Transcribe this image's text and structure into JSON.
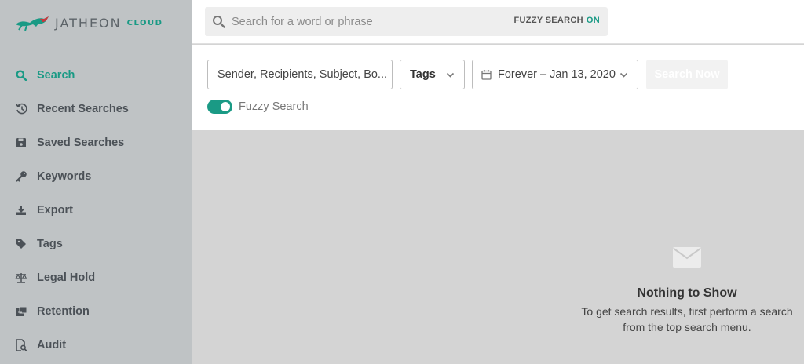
{
  "brand": {
    "name": "JATHEON",
    "suffix": "CLOUD"
  },
  "colors": {
    "accent": "#1a9a85",
    "sidebar": "#bfc3c5",
    "content": "#d4d4d4"
  },
  "sidebar": {
    "items": [
      {
        "label": "Search",
        "icon": "search-icon",
        "active": true
      },
      {
        "label": "Recent Searches",
        "icon": "history-icon"
      },
      {
        "label": "Saved Searches",
        "icon": "save-icon"
      },
      {
        "label": "Keywords",
        "icon": "key-icon"
      },
      {
        "label": "Export",
        "icon": "download-icon"
      },
      {
        "label": "Tags",
        "icon": "tag-icon"
      },
      {
        "label": "Legal Hold",
        "icon": "scale-icon"
      },
      {
        "label": "Retention",
        "icon": "archive-icon"
      },
      {
        "label": "Audit",
        "icon": "audit-icon"
      }
    ]
  },
  "topbar": {
    "search_placeholder": "Search for a word or phrase",
    "fuzzy_label": "FUZZY SEARCH",
    "fuzzy_state": "ON"
  },
  "toolbar": {
    "query_fields": "Sender, Recipients, Subject, Bo...",
    "tags_label": "Tags",
    "date_range": "Forever – Jan 13, 2020",
    "search_button": "Search Now",
    "fuzzy_toggle_label": "Fuzzy Search",
    "fuzzy_toggle_on": true
  },
  "empty_state": {
    "icon": "envelope-icon",
    "title": "Nothing to Show",
    "message_line1": "To get search results, first perform a search",
    "message_line2": "from the top search menu."
  }
}
